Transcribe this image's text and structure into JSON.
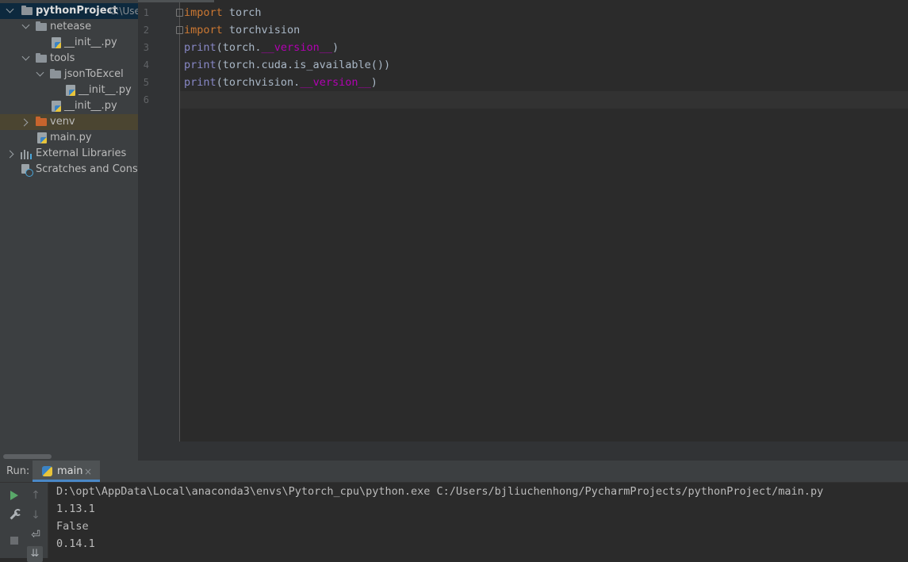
{
  "project_tree": {
    "root": {
      "name": "pythonProject",
      "path_hint": "C:\\Use"
    },
    "items": [
      {
        "label": "netease"
      },
      {
        "label": "__init__.py"
      },
      {
        "label": "tools"
      },
      {
        "label": "jsonToExcel"
      },
      {
        "label": "__init__.py"
      },
      {
        "label": "__init__.py"
      },
      {
        "label": "venv"
      },
      {
        "label": "main.py"
      },
      {
        "label": "External Libraries"
      },
      {
        "label": "Scratches and Consoles"
      }
    ]
  },
  "editor": {
    "line_numbers": [
      "1",
      "2",
      "3",
      "4",
      "5",
      "6"
    ],
    "lines": [
      {
        "kw": "import",
        "rest": " torch"
      },
      {
        "kw": "import",
        "rest": " torchvision"
      },
      {
        "fn": "print",
        "pre": "(torch.",
        "dunder": "__version__",
        "post": ")"
      },
      {
        "fn": "print",
        "rest": "(torch.cuda.is_available())"
      },
      {
        "fn": "print",
        "pre": "(torchvision.",
        "dunder": "__version__",
        "post": ")"
      }
    ]
  },
  "run_panel": {
    "title": "Run:",
    "tab_label": "main",
    "tab_close": "×",
    "output": [
      "D:\\opt\\AppData\\Local\\anaconda3\\envs\\Pytorch_cpu\\python.exe C:/Users/bjliuchenhong/PycharmProjects/pythonProject/main.py",
      "1.13.1",
      "False",
      "0.14.1"
    ]
  },
  "colors": {
    "keyword": "#cc7832",
    "builtin": "#8888c6",
    "dunder": "#b200b2",
    "selection": "#0d293e",
    "accent": "#4a88c7"
  }
}
